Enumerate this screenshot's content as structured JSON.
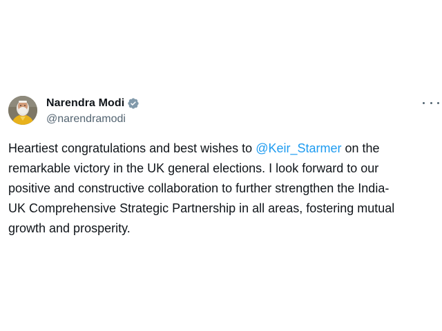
{
  "author": {
    "name": "Narendra Modi",
    "handle": "@narendramodi",
    "verified_badge": "verified-badge-icon"
  },
  "more_menu": {
    "icon": "more-horizontal-icon"
  },
  "tweet": {
    "line1_before": "Heartiest congratulations and best wishes to ",
    "mention": "@Keir_Starmer",
    "line1_after": " on the",
    "line2": "remarkable victory in the UK general elections. I look forward to our",
    "line3": "positive and constructive collaboration to further strengthen the India-",
    "line4": "UK Comprehensive Strategic Partnership in all areas, fostering mutual",
    "line5": "growth and prosperity."
  },
  "colors": {
    "text": "#0f1419",
    "secondary": "#536471",
    "accent": "#1d9bf0"
  }
}
